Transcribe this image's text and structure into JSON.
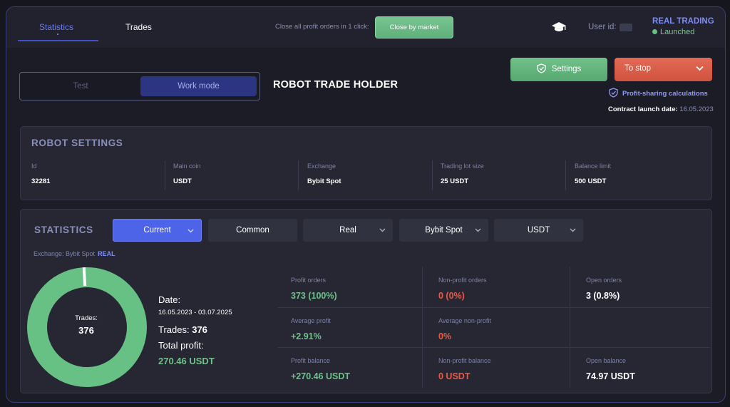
{
  "tabs": {
    "statistics": "Statistics",
    "trades": "Trades"
  },
  "header": {
    "close_hint": "Close all profit orders in 1 click:",
    "close_by_market": "Close by market",
    "user_id_label": "User id:",
    "mode_title": "REAL TRADING",
    "status": "Launched"
  },
  "mode": {
    "test": "Test",
    "work": "Work mode"
  },
  "robot_title": "ROBOT TRADE HOLDER",
  "actions": {
    "settings": "Settings",
    "stop": "To stop",
    "profit_sharing": "Profit-sharing calculations",
    "contract_label": "Contract launch date:",
    "contract_date": "16.05.2023"
  },
  "robot_settings": {
    "title": "ROBOT SETTINGS",
    "fields": [
      {
        "label": "Id",
        "value": "32281"
      },
      {
        "label": "Main coin",
        "value": "USDT"
      },
      {
        "label": "Exchange",
        "value": "Bybit Spot"
      },
      {
        "label": "Trading lot size",
        "value": "25 USDT"
      },
      {
        "label": "Balance limit",
        "value": "500 USDT"
      }
    ]
  },
  "statistics": {
    "title": "STATISTICS",
    "filters": {
      "period": "Current",
      "scope": "Common",
      "type": "Real",
      "exchange": "Bybit Spot",
      "coin": "USDT"
    },
    "exchange_label": "Exchange: Bybit Spot",
    "exchange_mode": "REAL",
    "donut": {
      "label": "Trades:",
      "value": "376",
      "profit_fraction": 0.992,
      "color": "#67c184",
      "marker_color": "#ffffff"
    },
    "summary": {
      "date_label": "Date:",
      "date_range": "16.05.2023 - 03.07.2025",
      "trades_label": "Trades:",
      "trades_value": "376",
      "profit_label": "Total profit:",
      "profit_value": "270.46 USDT"
    },
    "metrics": {
      "profit_orders": {
        "label": "Profit orders",
        "value": "373 (100%)"
      },
      "nonprofit_orders": {
        "label": "Non-profit orders",
        "value": "0 (0%)"
      },
      "open_orders": {
        "label": "Open orders",
        "value": "3 (0.8%)"
      },
      "avg_profit": {
        "label": "Average profit",
        "value": "+2.91%"
      },
      "avg_nonprofit": {
        "label": "Average non-profit",
        "value": "0%"
      },
      "profit_balance": {
        "label": "Profit balance",
        "value": "+270.46 USDT"
      },
      "nonprofit_balance": {
        "label": "Non-profit balance",
        "value": "0 USDT"
      },
      "open_balance": {
        "label": "Open balance",
        "value": "74.97 USDT"
      }
    }
  },
  "colors": {
    "accent": "#4e64e8",
    "green": "#67c184",
    "red": "#e85a47"
  }
}
